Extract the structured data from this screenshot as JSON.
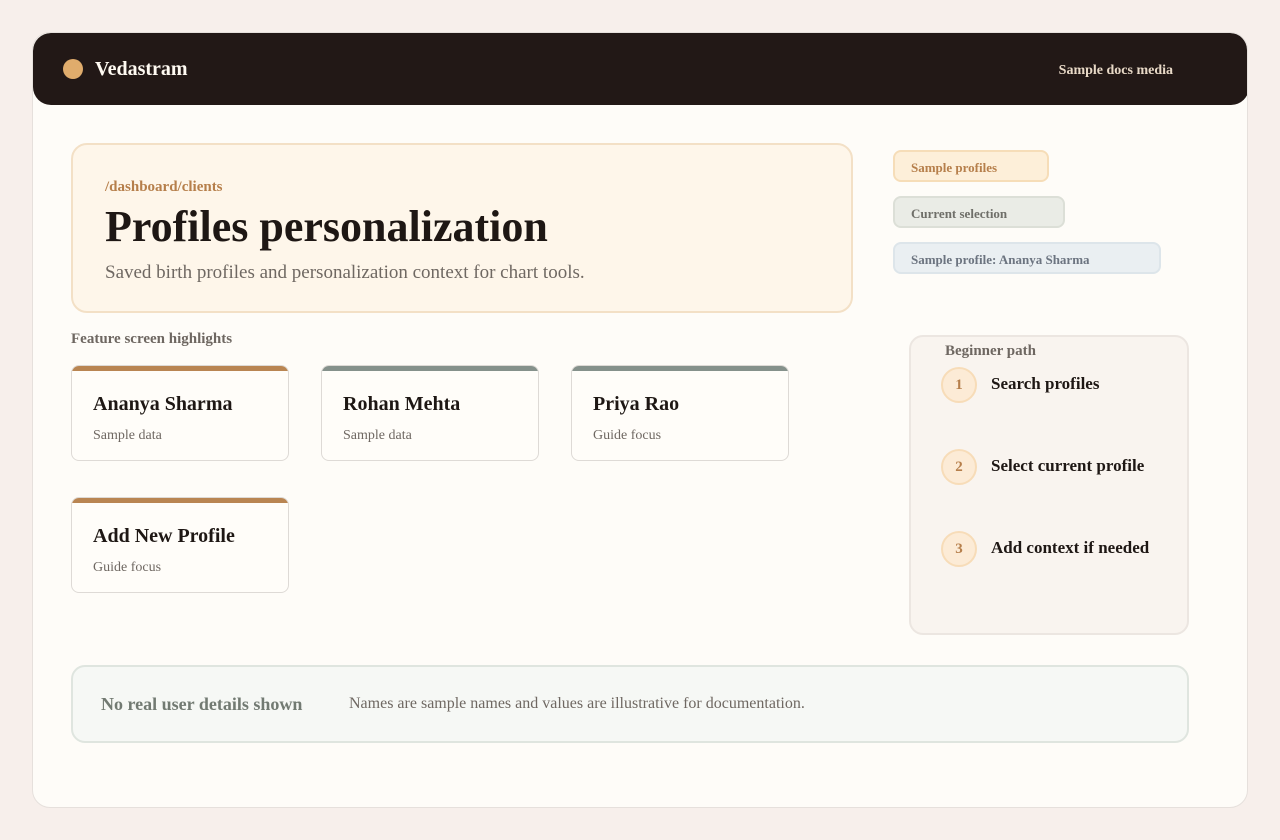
{
  "app": {
    "brand": "Vedastram",
    "top_link": "Sample docs media"
  },
  "hero": {
    "path": "/dashboard/clients",
    "title": "Profiles personalization",
    "description": "Saved birth profiles and personalization context for chart tools."
  },
  "pills": [
    {
      "label": "Sample profiles"
    },
    {
      "label": "Current selection"
    },
    {
      "label": "Sample profile: Ananya Sharma"
    }
  ],
  "highlights": {
    "label": "Feature screen highlights",
    "cards": [
      {
        "name": "Ananya Sharma",
        "sub": "Sample data",
        "accent": "#b98552"
      },
      {
        "name": "Rohan Mehta",
        "sub": "Sample data",
        "accent": "#85918b"
      },
      {
        "name": "Priya Rao",
        "sub": "Guide focus",
        "accent": "#85918b"
      },
      {
        "name": "Add New Profile",
        "sub": "Guide focus",
        "accent": "#b98552"
      }
    ]
  },
  "beginner_path": {
    "title": "Beginner path",
    "steps": [
      {
        "num": "1",
        "label": "Search profiles"
      },
      {
        "num": "2",
        "label": "Select current profile"
      },
      {
        "num": "3",
        "label": "Add context if needed"
      }
    ]
  },
  "notice": {
    "title": "No real user details shown",
    "text": "Names are sample names and values are illustrative for documentation."
  },
  "colors": {
    "topbar": "#221816",
    "brand_dot": "#e0ac6c",
    "accent_orange": "#b98552",
    "accent_gray": "#85918b"
  }
}
